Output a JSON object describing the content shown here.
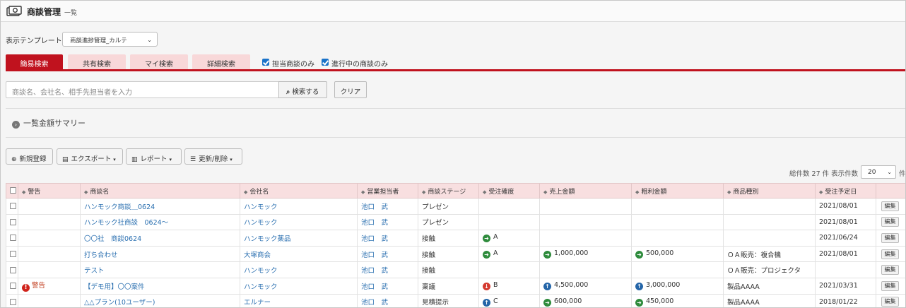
{
  "header": {
    "title": "商談管理",
    "subtitle": "一覧"
  },
  "template": {
    "label": "表示テンプレート",
    "selected": "商談進捗管理_カルテ"
  },
  "tabs": [
    "簡易検索",
    "共有検索",
    "マイ検索",
    "詳細検索"
  ],
  "filters": {
    "own_deals": "担当商談のみ",
    "in_progress": "進行中の商談のみ"
  },
  "search": {
    "placeholder": "商談名、会社名、相手先担当者を入力",
    "button": "検索する",
    "clear": "クリア"
  },
  "summary": {
    "label": "一覧金額サマリー"
  },
  "toolbar": {
    "new": "新規登録",
    "export": "エクスポート",
    "report": "レポート",
    "update": "更新/削除"
  },
  "paging": {
    "total": "総件数 27 件 表示件数",
    "per_page": "20",
    "unit": "件"
  },
  "columns": [
    "警告",
    "商談名",
    "会社名",
    "営業担当者",
    "商談ステージ",
    "受注確度",
    "売上金額",
    "粗利金額",
    "商品種別",
    "受注予定日"
  ],
  "colors": {
    "accent": "#c0121e",
    "link": "#2a6fb0",
    "header_bg": "#f8dfe0"
  },
  "rows": [
    {
      "warn": "",
      "deal": "ハンモック商談＿0624",
      "company": "ハンモック",
      "rep": "池口　武",
      "stage": "プレゼン",
      "prob": "",
      "prob_icon": "",
      "sales": "",
      "sales_icon": "",
      "profit": "",
      "profit_icon": "",
      "product": "",
      "date": "2021/08/01",
      "edit": "編集"
    },
    {
      "warn": "",
      "deal": "ハンモック社商談　0624～",
      "company": "ハンモック",
      "rep": "池口　武",
      "stage": "プレゼン",
      "prob": "",
      "prob_icon": "",
      "sales": "",
      "sales_icon": "",
      "profit": "",
      "profit_icon": "",
      "product": "",
      "date": "2021/08/01",
      "edit": "編集"
    },
    {
      "warn": "",
      "deal": "〇〇社　商談0624",
      "company": "ハンモック薬品",
      "rep": "池口　武",
      "stage": "接触",
      "prob": "A",
      "prob_icon": "green",
      "sales": "",
      "sales_icon": "",
      "profit": "",
      "profit_icon": "",
      "product": "",
      "date": "2021/06/24",
      "edit": "編集"
    },
    {
      "warn": "",
      "deal": "打ち合わせ",
      "company": "大塚商会",
      "rep": "池口　武",
      "stage": "接触",
      "prob": "A",
      "prob_icon": "green",
      "sales": "1,000,000",
      "sales_icon": "green",
      "profit": "500,000",
      "profit_icon": "green",
      "product": "ＯＡ販売：複合機",
      "date": "2021/08/01",
      "edit": "編集"
    },
    {
      "warn": "",
      "deal": "テスト",
      "company": "ハンモック",
      "rep": "池口　武",
      "stage": "接触",
      "prob": "",
      "prob_icon": "",
      "sales": "",
      "sales_icon": "",
      "profit": "",
      "profit_icon": "",
      "product": "ＯＡ販売：プロジェクタ",
      "date": "",
      "edit": "編集"
    },
    {
      "warn": "警告",
      "deal": "【デモ用】〇〇案件",
      "company": "ハンモック",
      "rep": "池口　武",
      "stage": "稟議",
      "prob": "B",
      "prob_icon": "red",
      "sales": "4,500,000",
      "sales_icon": "blue",
      "profit": "3,000,000",
      "profit_icon": "blue",
      "product": "製品AAAA",
      "date": "2021/03/31",
      "edit": "編集"
    },
    {
      "warn": "",
      "deal": "△△プラン(10ユーザー)",
      "company": "エルナー",
      "rep": "池口　武",
      "stage": "見積提示",
      "prob": "C",
      "prob_icon": "blue",
      "sales": "600,000",
      "sales_icon": "green",
      "profit": "450,000",
      "profit_icon": "green",
      "product": "製品AAAA",
      "date": "2018/01/22",
      "edit": "編集"
    }
  ]
}
